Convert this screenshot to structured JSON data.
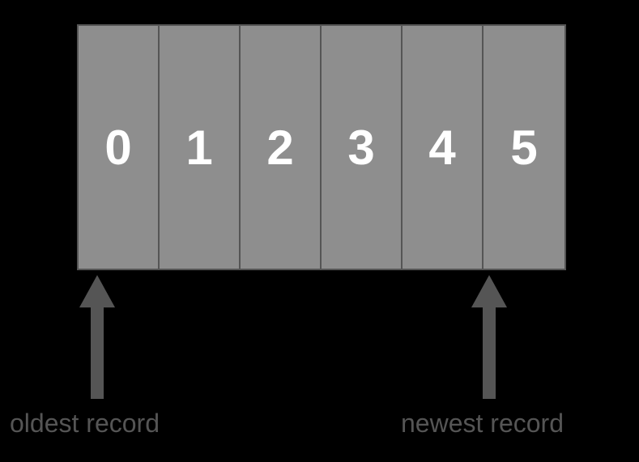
{
  "cells": [
    "0",
    "1",
    "2",
    "3",
    "4",
    "5"
  ],
  "labels": {
    "oldest": "oldest record",
    "newest": "newest record"
  }
}
